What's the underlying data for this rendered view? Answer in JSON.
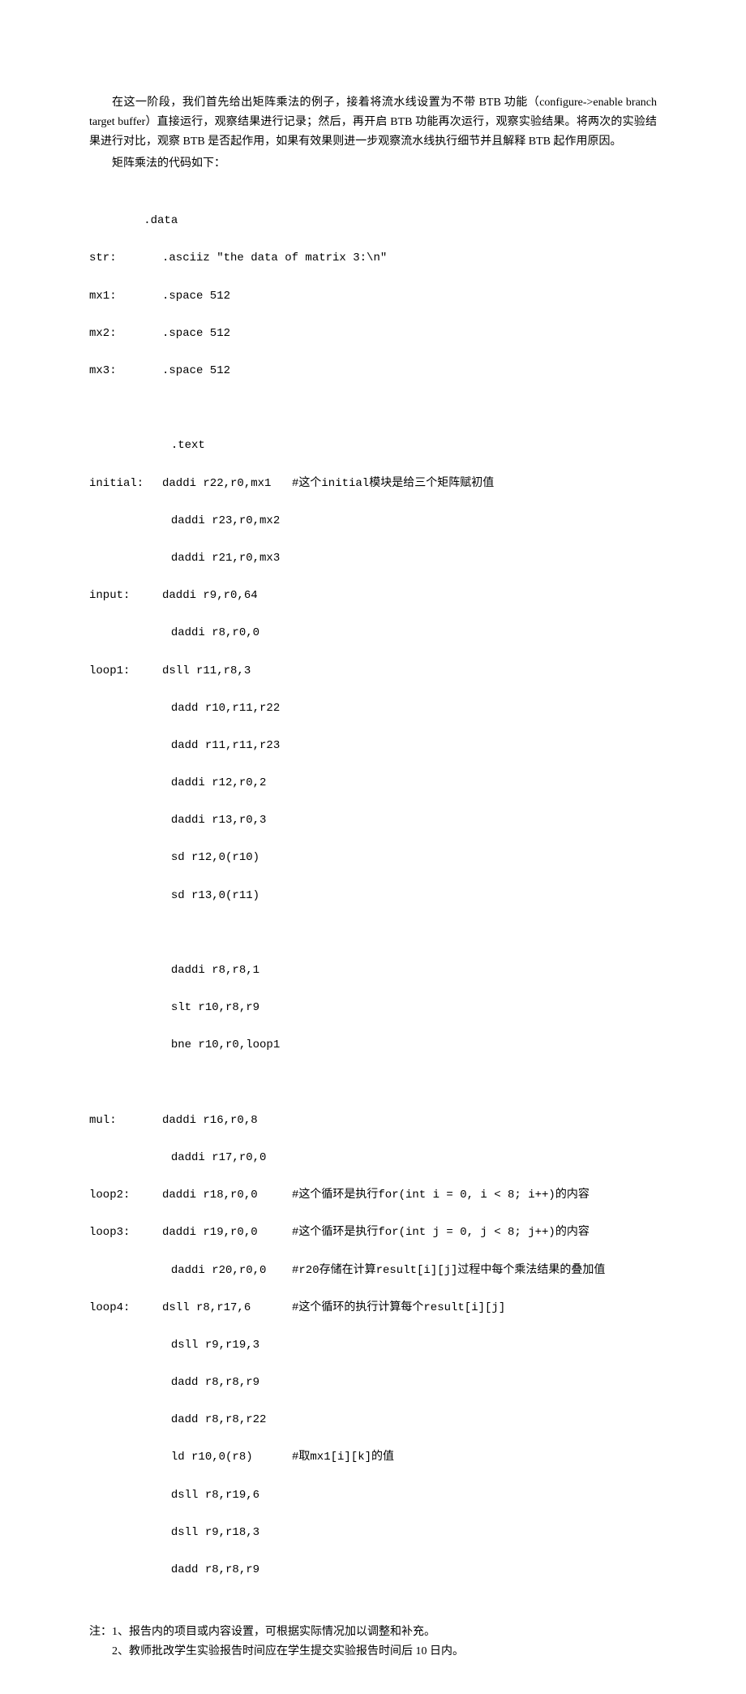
{
  "paragraphs": {
    "p1": "在这一阶段，我们首先给出矩阵乘法的例子，接着将流水线设置为不带 BTB 功能（configure->enable branch target buffer）直接运行，观察结果进行记录；然后，再开启 BTB 功能再次运行，观察实验结果。将两次的实验结果进行对比，观察 BTB 是否起作用，如果有效果则进一步观察流水线执行细节并且解释 BTB 起作用原因。",
    "p2": "矩阵乘法的代码如下："
  },
  "code": {
    "l1": "        .data",
    "l2a": "str:",
    "l2b": ".asciiz \"the data of matrix 3:\\n\"",
    "l3a": "mx1:",
    "l3b": ".space 512",
    "l4a": "mx2:",
    "l4b": ".space 512",
    "l5a": "mx3:",
    "l5b": ".space 512",
    "l6": "            .text",
    "l7a": "initial:",
    "l7b": "daddi r22,r0,mx1",
    "l7c": "#这个initial模块是给三个矩阵赋初值",
    "l8": "            daddi r23,r0,mx2",
    "l9": "            daddi r21,r0,mx3",
    "l10a": "input:",
    "l10b": "daddi r9,r0,64",
    "l11": "            daddi r8,r0,0",
    "l12a": "loop1:",
    "l12b": "dsll r11,r8,3",
    "l13": "            dadd r10,r11,r22",
    "l14": "            dadd r11,r11,r23",
    "l15": "            daddi r12,r0,2",
    "l16": "            daddi r13,r0,3",
    "l17": "            sd r12,0(r10)",
    "l18": "            sd r13,0(r11)",
    "l19": "            daddi r8,r8,1",
    "l20": "            slt r10,r8,r9",
    "l21": "            bne r10,r0,loop1",
    "l22a": "mul:",
    "l22b": "daddi r16,r0,8",
    "l23": "            daddi r17,r0,0",
    "l24a": "loop2:",
    "l24b": "daddi r18,r0,0",
    "l24c": "#这个循环是执行for(int i = 0, i < 8; i++)的内容",
    "l25a": "loop3:",
    "l25b": "daddi r19,r0,0",
    "l25c": "#这个循环是执行for(int j = 0, j < 8; j++)的内容",
    "l26": "            daddi r20,r0,0",
    "l26c": "#r20存储在计算result[i][j]过程中每个乘法结果的叠加值",
    "l27a": "loop4:",
    "l27b": "dsll r8,r17,6",
    "l27c": "#这个循环的执行计算每个result[i][j]",
    "l28": "            dsll r9,r19,3",
    "l29": "            dadd r8,r8,r9",
    "l30": "            dadd r8,r8,r22",
    "l31": "            ld r10,0(r8)",
    "l31c": "#取mx1[i][k]的值",
    "l32": "            dsll r8,r19,6",
    "l33": "            dsll r9,r18,3",
    "l34": "            dadd r8,r8,r9"
  },
  "footer": {
    "f1": "注：1、报告内的项目或内容设置，可根据实际情况加以调整和补充。",
    "f2": "　　2、教师批改学生实验报告时间应在学生提交实验报告时间后 10 日内。"
  }
}
